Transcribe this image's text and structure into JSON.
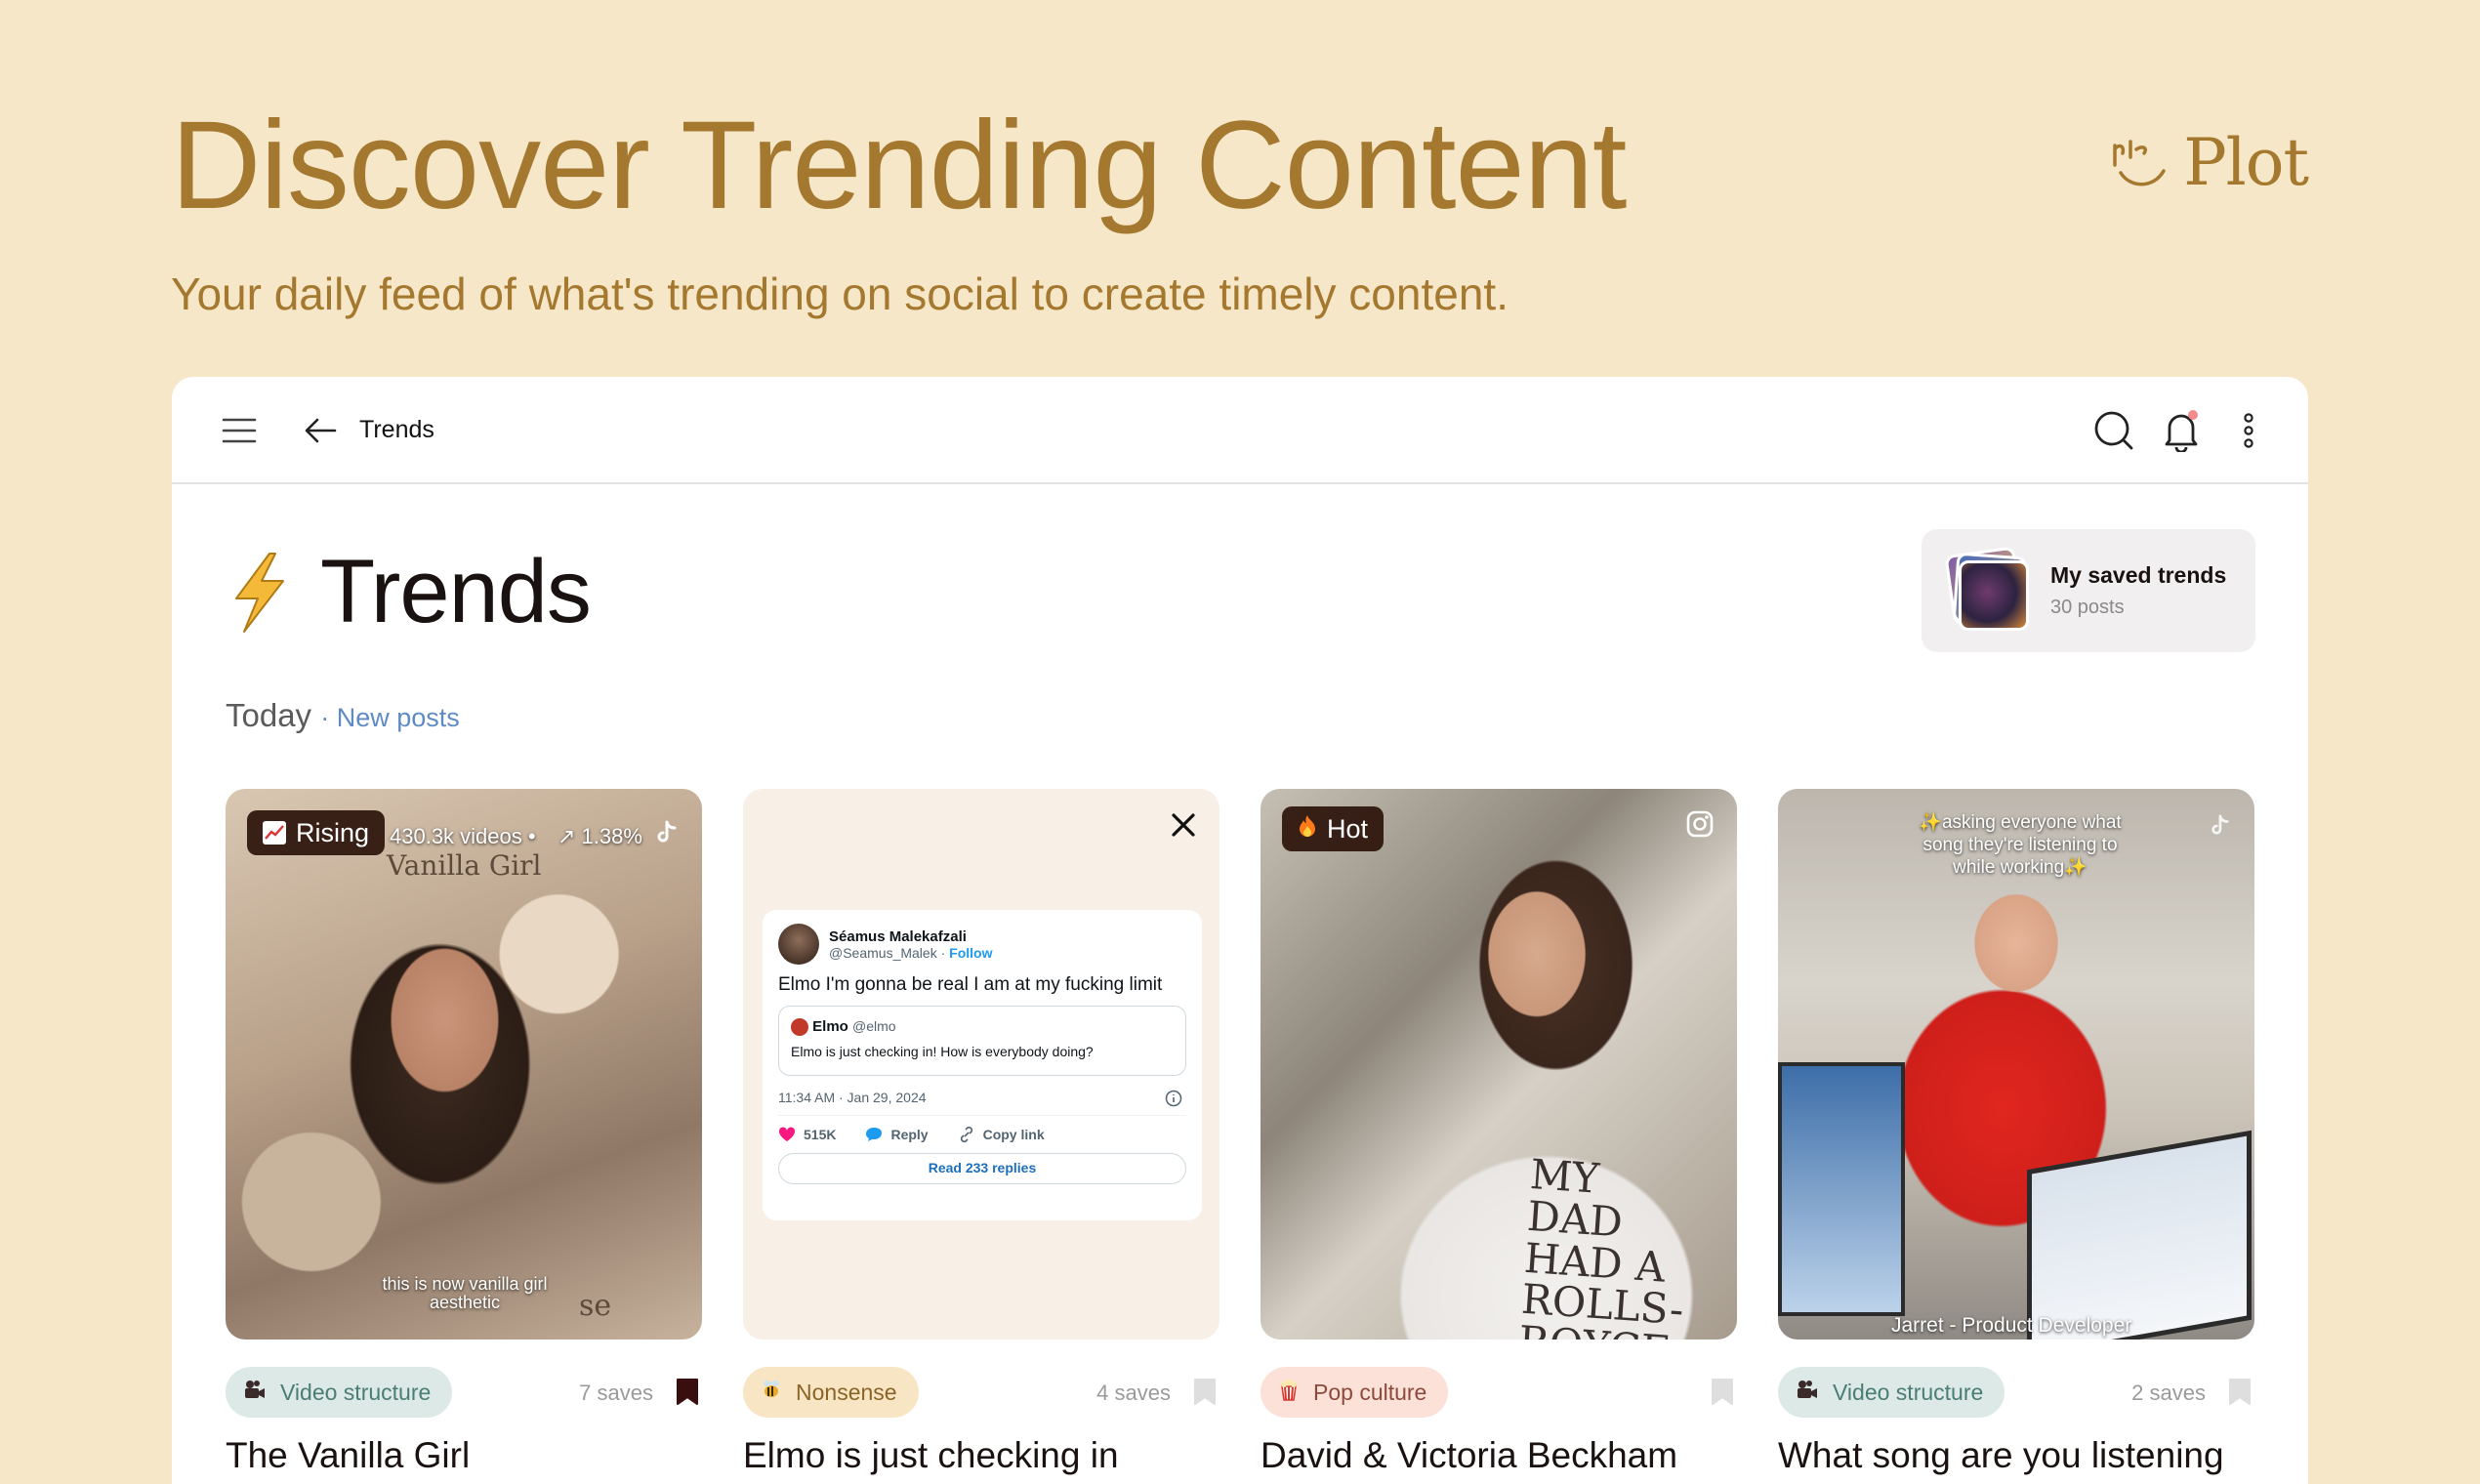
{
  "hero": {
    "title": "Discover Trending Content",
    "subtitle": "Your daily feed of what's trending on social to create timely content.",
    "brand": "Plot"
  },
  "topbar": {
    "title": "Trends",
    "icons": [
      "hamburger-menu-icon",
      "back-arrow-icon",
      "search-icon",
      "bell-icon",
      "more-vertical-icon"
    ]
  },
  "page": {
    "title": "Trends",
    "icon": "lightning-icon",
    "today_label": "Today",
    "new_posts": "· New posts"
  },
  "saved": {
    "title": "My saved trends",
    "count": "30 posts"
  },
  "colors": {
    "background": "#f7e7c9",
    "accent": "#a4792f",
    "link": "#5f8bc4"
  },
  "cards": [
    {
      "badge": "Rising",
      "stats_videos": "430.3k videos •",
      "stats_growth": "↗ 1.38%",
      "platform": "tiktok",
      "overlay_top": "Vanilla Girl",
      "overlay_bottom": "this is now vanilla girl aesthetic",
      "overlay_corner": "se",
      "tag": "Video structure",
      "saves": "7 saves",
      "bookmarked": true,
      "title": "The Vanilla Girl"
    },
    {
      "platform": "x",
      "tweet": {
        "name": "Séamus Malekafzali",
        "handle": "@Seamus_Malek ·",
        "follow": "Follow",
        "text": "Elmo I'm gonna be real I am at my fucking limit",
        "quote_name": "Elmo",
        "quote_handle": "@elmo",
        "quote_text": "Elmo is just checking in! How is everybody doing?",
        "time": "11:34 AM · Jan 29, 2024",
        "likes": "515K",
        "reply": "Reply",
        "copy": "Copy link",
        "read": "Read 233 replies"
      },
      "tag": "Nonsense",
      "saves": "4 saves",
      "bookmarked": false,
      "title": "Elmo is just checking in"
    },
    {
      "badge": "Hot",
      "platform": "instagram",
      "shirt_text": "MY DAD HAD A ROLLS- ROYCE",
      "tag": "Pop culture",
      "saves": "",
      "bookmarked": false,
      "title": "David & Victoria Beckham"
    },
    {
      "platform": "tiktok",
      "overlay_top": "✨asking everyone what song they're listening to while working✨",
      "overlay_bottom": "Jarret - Product Developer",
      "tag": "Video structure",
      "saves": "2 saves",
      "bookmarked": false,
      "title": "What song are you listening"
    }
  ]
}
